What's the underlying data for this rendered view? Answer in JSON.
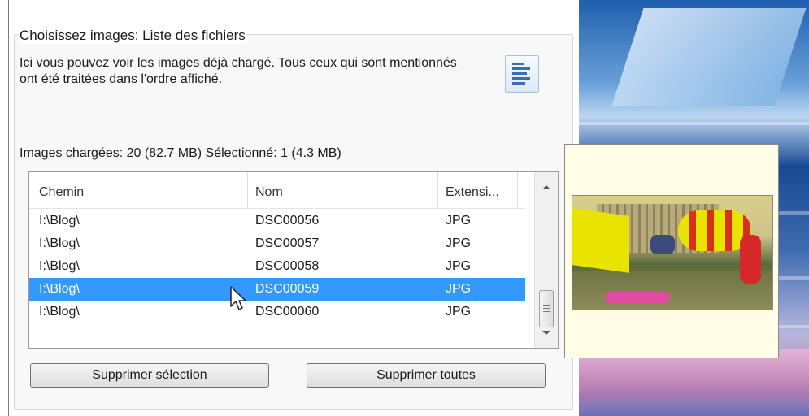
{
  "group": {
    "title": "Choisissez images: Liste des fichiers",
    "description": "Ici vous pouvez voir les images déjà chargé. Tous ceux qui sont mentionnés ont été traitées dans l'ordre affiché.",
    "stats": "Images chargées: 20 (82.7 MB)   Sélectionné: 1 (4.3 MB)"
  },
  "table": {
    "columns": [
      "Chemin",
      "Nom",
      "Extensi..."
    ],
    "rows": [
      {
        "path": "I:\\Blog\\",
        "name": "DSC00056",
        "ext": "JPG",
        "selected": false
      },
      {
        "path": "I:\\Blog\\",
        "name": "DSC00057",
        "ext": "JPG",
        "selected": false
      },
      {
        "path": "I:\\Blog\\",
        "name": "DSC00058",
        "ext": "JPG",
        "selected": false
      },
      {
        "path": "I:\\Blog\\",
        "name": "DSC00059",
        "ext": "JPG",
        "selected": true
      },
      {
        "path": "I:\\Blog\\",
        "name": "DSC00060",
        "ext": "JPG",
        "selected": false
      }
    ]
  },
  "buttons": {
    "delete_selection": "Supprimer sélection",
    "delete_all": "Supprimer toutes"
  },
  "colors": {
    "selection": "#3399ff",
    "tooltip_bg": "#fffde6"
  },
  "icons": {
    "list_view": "list-view-icon",
    "cursor": "mouse-pointer-icon"
  }
}
